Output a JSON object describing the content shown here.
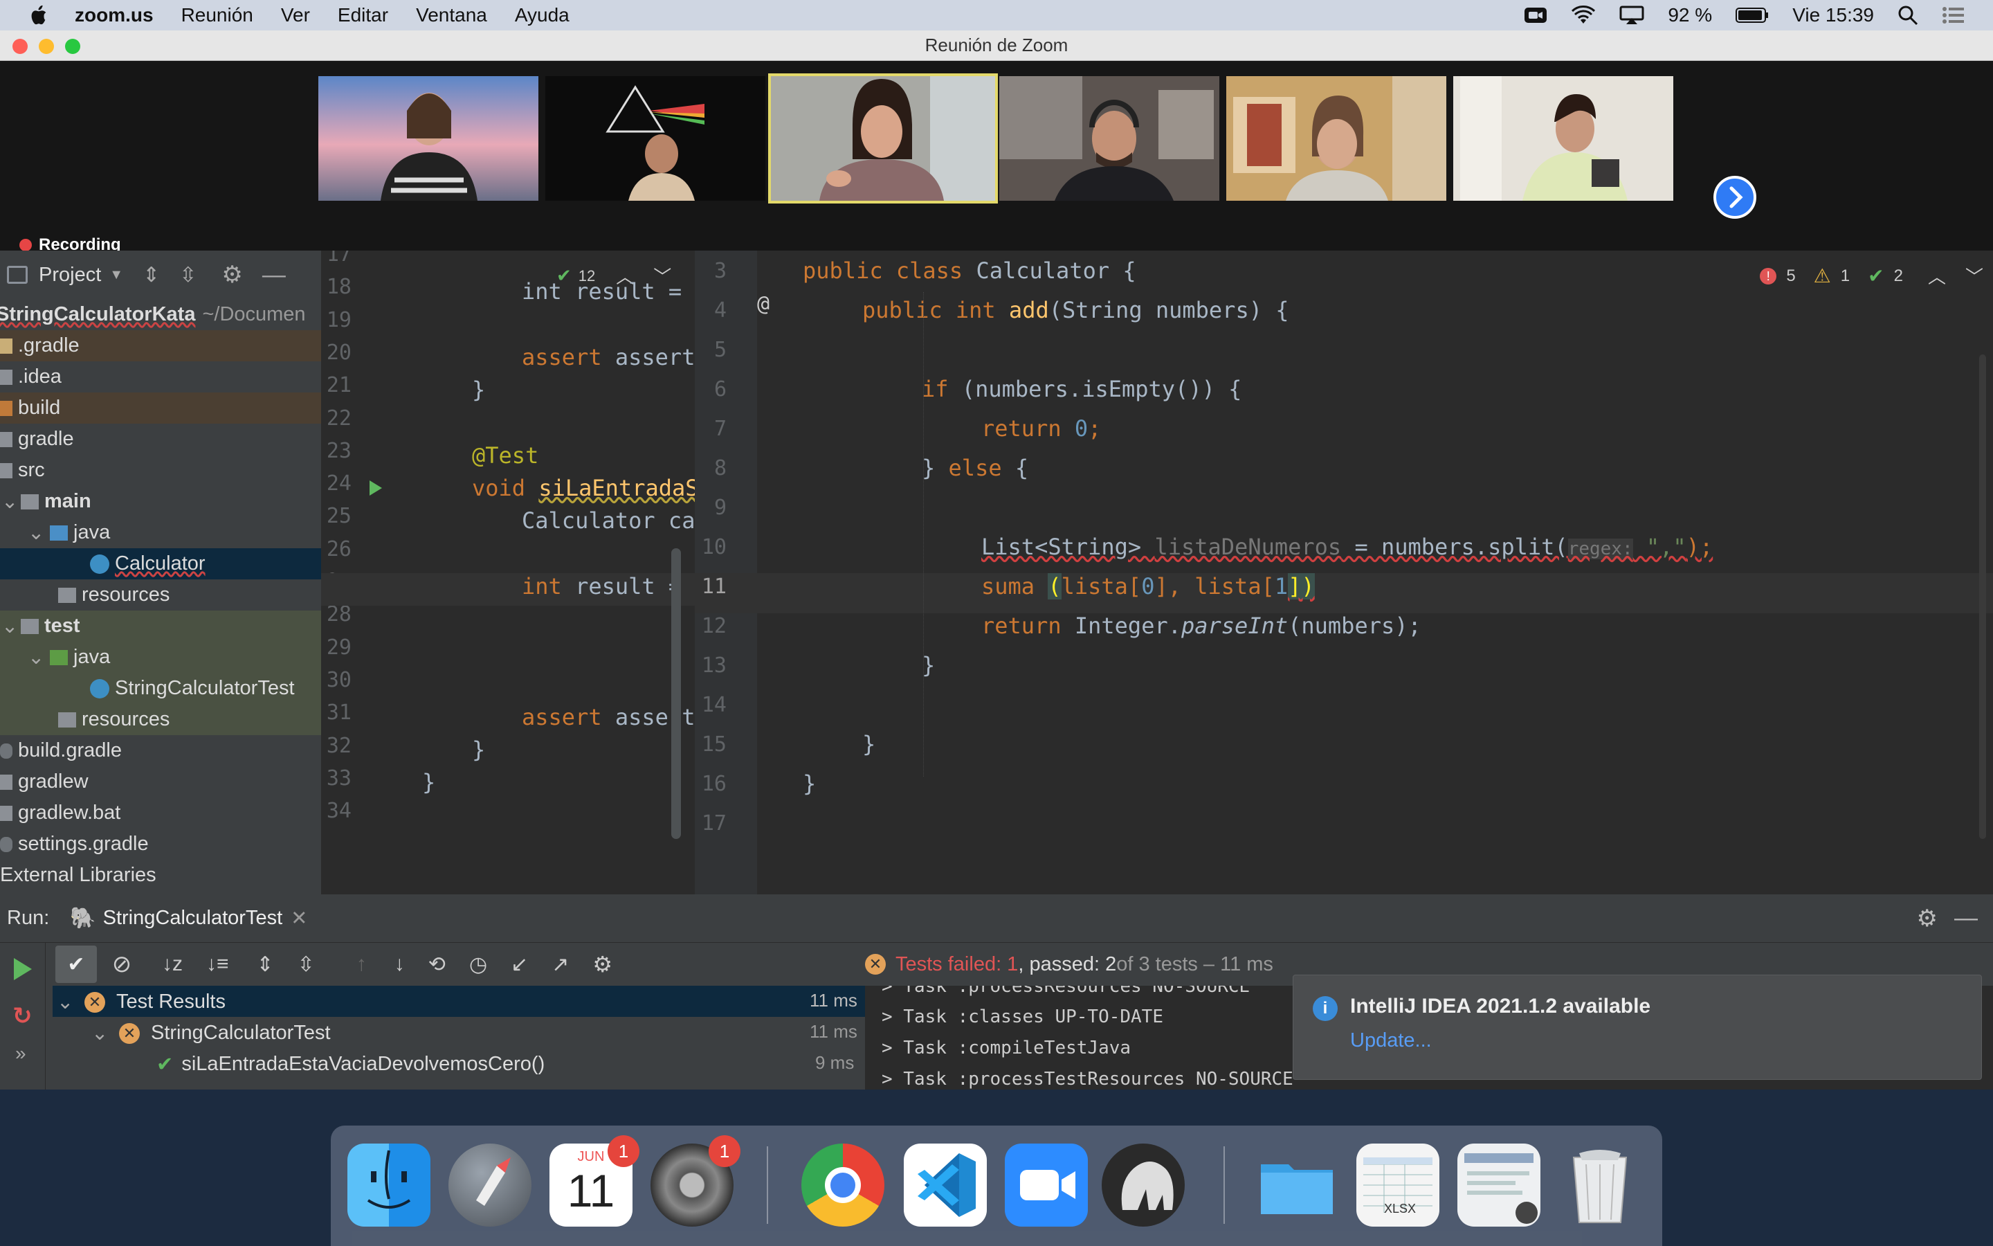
{
  "menubar": {
    "app": "zoom.us",
    "items": [
      "Reunión",
      "Ver",
      "Editar",
      "Ventana",
      "Ayuda"
    ],
    "battery": "92 %",
    "clock": "Vie 15:39"
  },
  "window": {
    "title": "Reunión de Zoom"
  },
  "zoom": {
    "recording_label": "Recording",
    "participant_tiles": 6,
    "selected_tile": 3
  },
  "ide": {
    "project": {
      "header": "Project",
      "root_name": "StringCalculatorKata",
      "root_path": "~/Documen",
      "tree": [
        ".gradle",
        ".idea",
        "build",
        "gradle",
        "src",
        "main",
        "java",
        "Calculator",
        "resources",
        "test",
        "java",
        "StringCalculatorTest",
        "resources",
        "build.gradle",
        "gradlew",
        "gradlew.bat",
        "settings.gradle",
        "External Libraries"
      ]
    },
    "left_editor": {
      "line_numbers": [
        "17",
        "18",
        "19",
        "20",
        "21",
        "22",
        "23",
        "24",
        "25",
        "26",
        "27",
        "28",
        "29",
        "30",
        "31",
        "32",
        "33",
        "34"
      ],
      "check_count": "12",
      "lines": {
        "l18": "int result = (",
        "l20": "assert ( resul",
        "l21": "}",
        "l23": "@Test",
        "l24a": "void ",
        "l24b": "siLaEntradaSe",
        "l25": "Calculator ca",
        "l27a": "int",
        "l27b": " result = (",
        "l31": "assert ( resul",
        "l32": "}",
        "l33": "}"
      }
    },
    "main_editor": {
      "line_numbers": [
        "3",
        "4",
        "5",
        "6",
        "7",
        "8",
        "9",
        "10",
        "11",
        "12",
        "13",
        "14",
        "15",
        "16",
        "17"
      ],
      "at_marker": "@",
      "inspections": {
        "errors": "5",
        "warnings": "1",
        "ok": "2"
      },
      "lines": {
        "l3": [
          "public ",
          "class ",
          "Calculator {"
        ],
        "l4": [
          "public ",
          "int ",
          "add",
          "(String numbers) {"
        ],
        "l6": [
          "if ",
          "(numbers.isEmpty()) {"
        ],
        "l7": [
          "return ",
          "0",
          ";"
        ],
        "l8": [
          "} ",
          "else",
          " {"
        ],
        "l10": [
          "List<String> ",
          "listaDeNumeros",
          " = numbers.split(",
          "regex:",
          " \",\"",
          ");"
        ],
        "l11": [
          "suma ",
          "(",
          "lista[",
          "0",
          "], ",
          "lista[",
          "1",
          "])"
        ],
        "l12": [
          "return ",
          "Integer.",
          "parseInt",
          "(numbers);"
        ],
        "l13": "}",
        "l15": "}",
        "l16": "}"
      }
    },
    "run": {
      "label": "Run:",
      "tab": "StringCalculatorTest",
      "status_failed": "Tests failed: 1",
      "status_passed": ", passed: 2",
      "status_rest": " of 3 tests – 11 ms",
      "tests": [
        {
          "name": "Test Results",
          "time": "11 ms"
        },
        {
          "name": "StringCalculatorTest",
          "time": "11 ms"
        },
        {
          "name": "siLaEntradaEstaVaciaDevolvemosCero()",
          "time": "9 ms"
        }
      ],
      "console": [
        "> Task :processResources NO-SOURCE",
        "> Task :classes UP-TO-DATE",
        "> Task :compileTestJava",
        "> Task :processTestResources NO-SOURCE"
      ]
    },
    "notification": {
      "title": "IntelliJ IDEA 2021.1.2 available",
      "link": "Update..."
    }
  },
  "dock": {
    "calendar_month": "JUN",
    "calendar_day": "11",
    "calendar_badge": "1",
    "settings_badge": "1",
    "items": [
      "finder-icon",
      "launchpad-icon",
      "calendar-icon",
      "system-preferences-icon",
      "chrome-icon",
      "vscode-icon",
      "zoom-icon",
      "mamp-icon",
      "folder-icon",
      "spreadsheet-icon",
      "document-icon",
      "trash-icon"
    ],
    "xlsx_label": "XLSX"
  },
  "colors": {
    "accent_blue": "#2f7bf5",
    "error_red": "#e05555",
    "ok_green": "#5fb85f"
  }
}
